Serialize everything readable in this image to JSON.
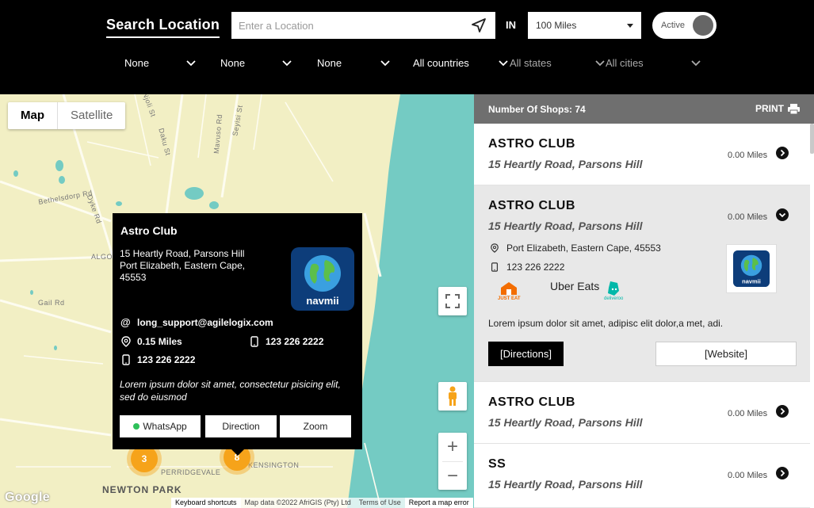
{
  "header": {
    "title": "Search Location",
    "location_placeholder": "Enter a Location",
    "in_label": "IN",
    "radius_selected": "100 Miles",
    "active_label": "Active"
  },
  "filters": [
    {
      "label": "None"
    },
    {
      "label": "None"
    },
    {
      "label": "None"
    },
    {
      "label": "All countries"
    },
    {
      "label": "All states"
    },
    {
      "label": "All cities"
    }
  ],
  "map": {
    "type_map": "Map",
    "type_satellite": "Satellite",
    "labels": [
      "Njoli St",
      "Daku St",
      "Mavuso Rd",
      "Seyisi St",
      "Bethelsdorp Rd",
      "Dyke Rd",
      "ALGOA",
      "Gail Rd",
      "PERRIDGEVALE",
      "KENSINGTON",
      "NEWTON PARK"
    ],
    "clusters": [
      "3",
      "8"
    ],
    "zoom_in": "+",
    "zoom_out": "−",
    "google": "Google",
    "attribution": {
      "shortcuts": "Keyboard shortcuts",
      "data": "Map data ©2022 AfriGIS (Pty) Ltd",
      "terms": "Terms of Use",
      "report": "Report a map error"
    }
  },
  "info_window": {
    "title": "Astro Club",
    "address_line1": "15 Heartly Road, Parsons Hill",
    "address_line2": "Port Elizabeth, Eastern Cape, 45553",
    "email": "long_support@agilelogix.com",
    "distance": "0.15 Miles",
    "phone1": "123 226 2222",
    "phone2": "123 226 2222",
    "description": "Lorem ipsum dolor sit amet, consectetur pisicing elit, sed do eiusmod",
    "btn_whatsapp": "WhatsApp",
    "btn_direction": "Direction",
    "btn_zoom": "Zoom",
    "logo_text": "navmii"
  },
  "sidebar": {
    "count_label": "Number Of Shops: 74",
    "print_label": "PRINT",
    "shops": [
      {
        "name": "ASTRO CLUB",
        "address": "15 Heartly Road, Parsons Hill",
        "distance": "0.00 Miles"
      },
      {
        "name": "ASTRO CLUB",
        "address": "15 Heartly Road, Parsons Hill",
        "distance": "0.00 Miles",
        "city": "Port Elizabeth, Eastern Cape, 45553",
        "phone": "123 226 2222",
        "delivery": [
          "JUST EAT",
          "Uber Eats",
          "deliveroo"
        ],
        "description": "Lorem ipsum dolor sit amet, adipisc elit dolor,a met, adi.",
        "btn_directions": "[Directions]",
        "btn_website": "[Website]",
        "logo_text": "navmii"
      },
      {
        "name": "ASTRO CLUB",
        "address": "15 Heartly Road, Parsons Hill",
        "distance": "0.00 Miles"
      },
      {
        "name": "SS",
        "address": "15 Heartly Road, Parsons Hill",
        "distance": "0.00 Miles"
      }
    ]
  },
  "colors": {
    "map_land": "#f2efc4",
    "map_water": "#74cbc3",
    "cluster": "#f6a31a",
    "header_bg": "#000000",
    "sidebar_head": "#6f6f6f"
  }
}
